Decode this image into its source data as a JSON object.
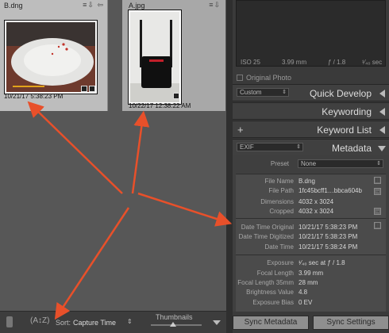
{
  "grid": {
    "cells": [
      {
        "name": "B.dng",
        "date": "10/21/17 5:38:23 PM"
      },
      {
        "name": "A.jpg",
        "date": "10/22/17 12:38:22 AM"
      }
    ]
  },
  "toolbar": {
    "sort_label": "Sort:",
    "sort_value": "Capture Time",
    "thumbnails_label": "Thumbnails"
  },
  "histogram": {
    "iso": "ISO 25",
    "focal": "3.99 mm",
    "aperture": "ƒ / 1.8",
    "shutter": "¹⁄₄₀ sec"
  },
  "original_photo_label": "Original Photo",
  "quick_develop": {
    "preset": "Custom",
    "title": "Quick Develop"
  },
  "keywording": {
    "title": "Keywording"
  },
  "keyword_list": {
    "add": "+",
    "title": "Keyword List"
  },
  "metadata": {
    "view": "EXIF",
    "title": "Metadata",
    "preset_label": "Preset",
    "preset_value": "None",
    "fields": [
      {
        "label": "File Name",
        "value": "B.dng"
      },
      {
        "label": "File Path",
        "value": "1fc45bcff1…bbca604b"
      },
      {
        "label": "Dimensions",
        "value": "4032 x 3024"
      },
      {
        "label": "Cropped",
        "value": "4032 x 3024"
      },
      {
        "label": "Date Time Original",
        "value": "10/21/17 5:38:23 PM"
      },
      {
        "label": "Date Time Digitized",
        "value": "10/21/17 5:38:23 PM"
      },
      {
        "label": "Date Time",
        "value": "10/21/17 5:38:24 PM"
      },
      {
        "label": "Exposure",
        "value": "¹⁄₄₀ sec at ƒ / 1.8"
      },
      {
        "label": "Focal Length",
        "value": "3.99 mm"
      },
      {
        "label": "Focal Length 35mm",
        "value": "28 mm"
      },
      {
        "label": "Brightness Value",
        "value": "4.8"
      },
      {
        "label": "Exposure Bias",
        "value": "0 EV"
      }
    ]
  },
  "buttons": {
    "sync_metadata": "Sync Metadata",
    "sync_settings": "Sync Settings"
  },
  "colors": {
    "annotation_arrow": "#e8502a",
    "panel_bg": "#3a3a3a",
    "grid_bg": "#575757"
  }
}
